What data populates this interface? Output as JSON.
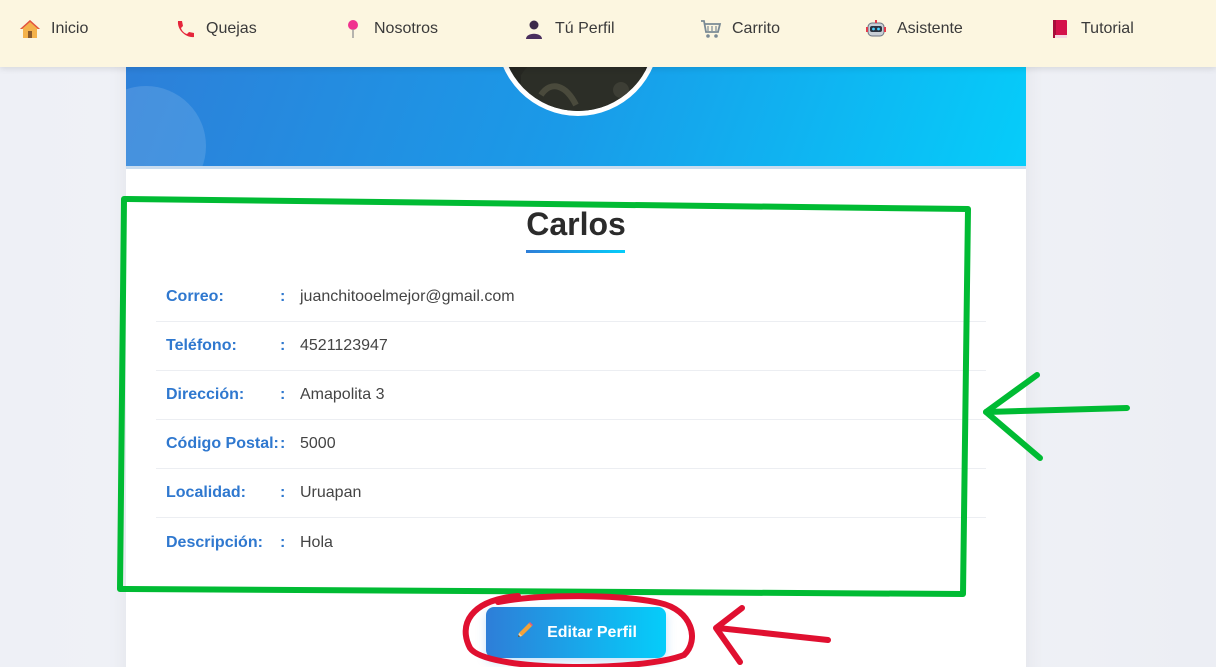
{
  "nav": {
    "items": [
      {
        "label": "Inicio",
        "icon": "house-icon"
      },
      {
        "label": "Quejas",
        "icon": "phone-icon"
      },
      {
        "label": "Nosotros",
        "icon": "pin-icon"
      },
      {
        "label": "Tú Perfil",
        "icon": "person-icon"
      },
      {
        "label": "Carrito",
        "icon": "cart-icon"
      },
      {
        "label": "Asistente",
        "icon": "robot-icon"
      },
      {
        "label": "Tutorial",
        "icon": "book-icon"
      }
    ]
  },
  "profile": {
    "name": "Carlos",
    "fields": [
      {
        "label": "Correo:",
        "colon": ":",
        "value": "juanchitooelmejor@gmail.com"
      },
      {
        "label": "Teléfono:",
        "colon": ":",
        "value": "4521123947"
      },
      {
        "label": "Dirección:",
        "colon": ":",
        "value": "Amapolita 3"
      },
      {
        "label": "Código Postal:",
        "colon": ":",
        "value": "5000"
      },
      {
        "label": "Localidad:",
        "colon": ":",
        "value": "Uruapan"
      },
      {
        "label": "Descripción:",
        "colon": ":",
        "value": "Hola"
      }
    ],
    "edit_button_label": "Editar Perfil",
    "edit_button_icon": "pencil-icon"
  },
  "colors": {
    "accent": "#2f78cf",
    "banner_start": "#2e7ed8",
    "banner_end": "#05cdfa",
    "annotation_green": "#00bb33",
    "annotation_red": "#e01030"
  }
}
